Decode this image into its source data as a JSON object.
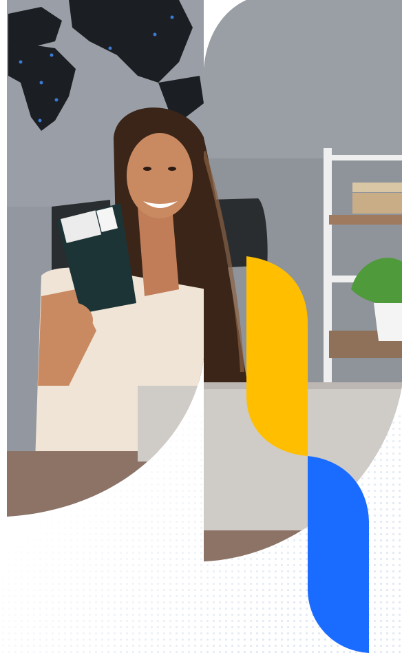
{
  "image": {
    "subject": "",
    "colors": {
      "wall": "#8f949b",
      "wall_light": "#a5aab1",
      "map": "#1b1e22",
      "map_dots": "#3a7bd5",
      "desk": "#8c7366",
      "laptop": "#cfcbc7",
      "shelf": "#efefef",
      "hair": "#3b2518",
      "skin": "#c98a62",
      "blouse": "#efe4d5",
      "passport": "#1d3436",
      "plant": "#4f9a3a",
      "accent_yellow": "#ffbf00",
      "accent_blue": "#1a6bff",
      "dot_pattern": "#dfe7f2"
    }
  }
}
